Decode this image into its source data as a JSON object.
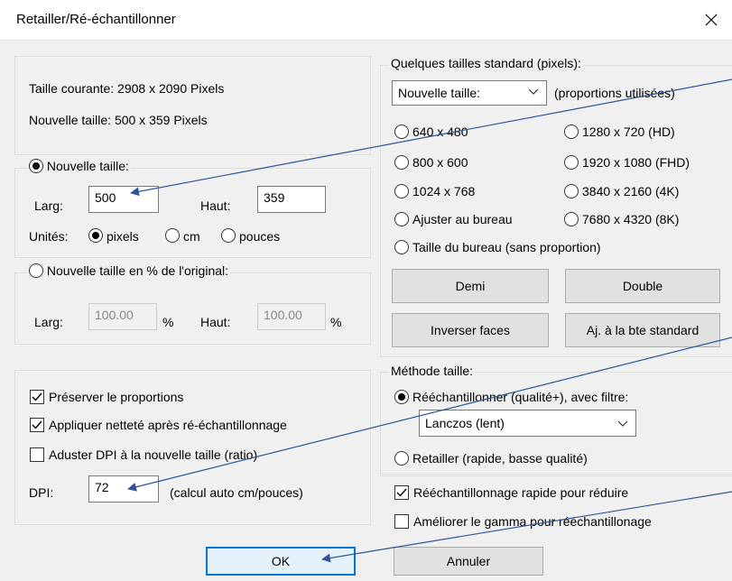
{
  "window": {
    "title": "Retailler/Ré-échantillonner"
  },
  "size_info": {
    "current": "Taille courante: 2908  x  2090  Pixels",
    "new": "Nouvelle taille:  500  x  359  Pixels"
  },
  "new_size": {
    "radio_label": "Nouvelle taille:",
    "width_label": "Larg:",
    "width_value": "500",
    "height_label": "Haut:",
    "height_value": "359",
    "units_label": "Unités:",
    "unit_pixels": "pixels",
    "unit_cm": "cm",
    "unit_inches": "pouces"
  },
  "percent_size": {
    "radio_label": "Nouvelle taille en % de l'original:",
    "width_label": "Larg:",
    "width_value": "100.00",
    "width_unit": "%",
    "height_label": "Haut:",
    "height_value": "100.00",
    "height_unit": "%"
  },
  "options": {
    "preserve": "Préserver le proportions",
    "sharpen": "Appliquer netteté après ré-échantillonnage",
    "adjust_dpi": "Aduster DPI à la nouvelle taille (ratio)",
    "dpi_label": "DPI:",
    "dpi_value": "72",
    "dpi_note": "(calcul auto cm/pouces)"
  },
  "standard": {
    "legend": "Quelques tailles standard (pixels):",
    "select_value": "Nouvelle taille:",
    "proportions_note": "(proportions utilisées)",
    "r640": "640 x 480",
    "r1280": "1280 x 720   (HD)",
    "r800": "800 x 600",
    "r1920": "1920 x 1080 (FHD)",
    "r1024": "1024 x 768",
    "r3840": "3840 x 2160 (4K)",
    "fit_desktop": "Ajuster au bureau",
    "r7680": "7680 x 4320 (8K)",
    "desktop_size": "Taille du bureau (sans proportion)",
    "half": "Demi",
    "double": "Double",
    "swap": "Inverser faces",
    "fit_std": "Aj. à la bte standard"
  },
  "method": {
    "legend": "Méthode taille:",
    "resample": "Rééchantillonner (qualité+), avec filtre:",
    "filter": "Lanczos (lent)",
    "resize": "Retailler (rapide, basse qualité)",
    "fast": "Rééchantillonnage rapide pour réduire",
    "gamma": "Améliorer le gamma pour rééchantillonage"
  },
  "buttons": {
    "ok": "OK",
    "cancel": "Annuler"
  },
  "colors": {
    "annotation_arrow": "#2f5597",
    "focus_border": "#0078d7"
  }
}
